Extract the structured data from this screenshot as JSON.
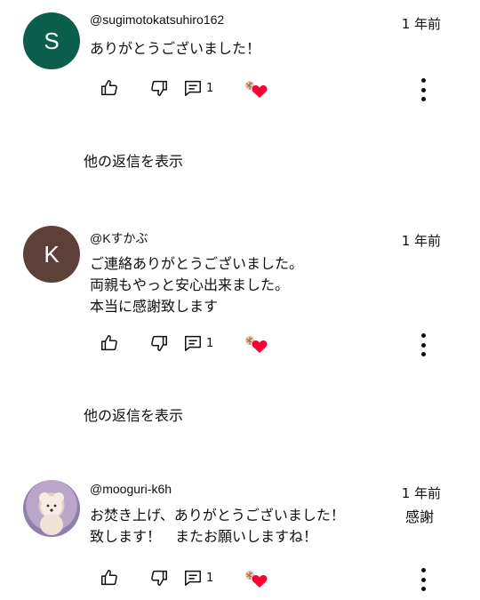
{
  "comments": [
    {
      "avatar_letter": "S",
      "avatar_color": "#0b5e4b",
      "handle": "@sugimotokatsuhiro162",
      "time": "1 年前",
      "text": "ありがとうございました！",
      "side_text": "",
      "reply_count": "1",
      "show_replies": "他の返信を表示"
    },
    {
      "avatar_letter": "K",
      "avatar_color": "#5d4037",
      "handle": "@Kすかぶ",
      "time": "1 年前",
      "text": "ご連絡ありがとうございました。\n両親もやっと安心出来ました。\n本当に感謝致します",
      "side_text": "",
      "reply_count": "1",
      "show_replies": "他の返信を表示"
    },
    {
      "avatar_letter": "",
      "avatar_color": "#9f8fc0",
      "handle": "@mooguri-k6h",
      "time": "1 年前",
      "text": "お焚き上げ、ありがとうございました！\n致します！　またお願いしますね！",
      "side_text": "感謝",
      "reply_count": "1",
      "show_replies": ""
    }
  ],
  "icons": {
    "like": "thumbs-up-icon",
    "dislike": "thumbs-down-icon",
    "reply": "comment-icon",
    "heart": "creator-heart-icon",
    "more": "more-vert-icon"
  },
  "colors": {
    "heart": "#ff0033",
    "text": "#0f0f0f"
  }
}
